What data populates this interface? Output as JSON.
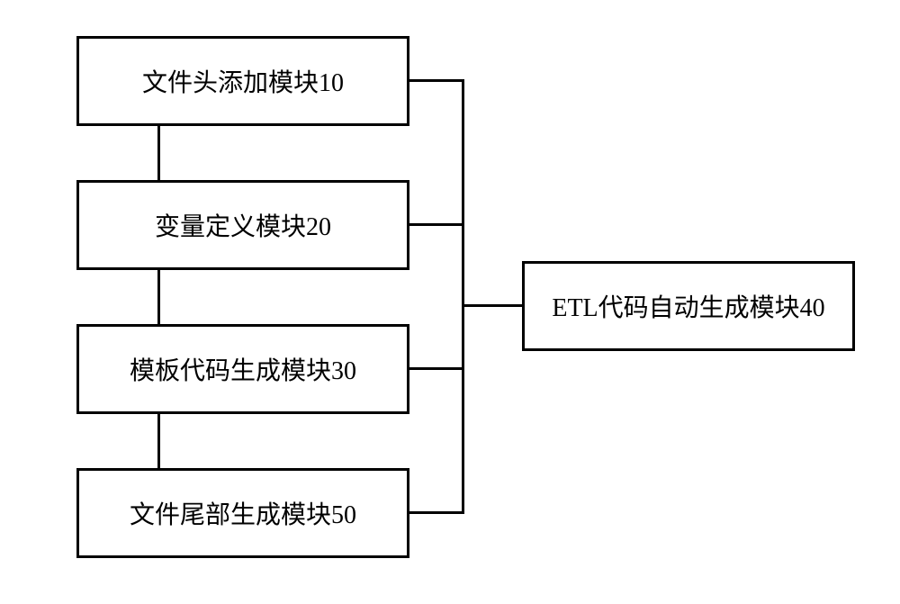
{
  "diagram": {
    "boxes": {
      "box1": "文件头添加模块10",
      "box2": "变量定义模块20",
      "box3": "模板代码生成模块30",
      "box4": "文件尾部生成模块50",
      "box5": "ETL代码自动生成模块40"
    }
  }
}
